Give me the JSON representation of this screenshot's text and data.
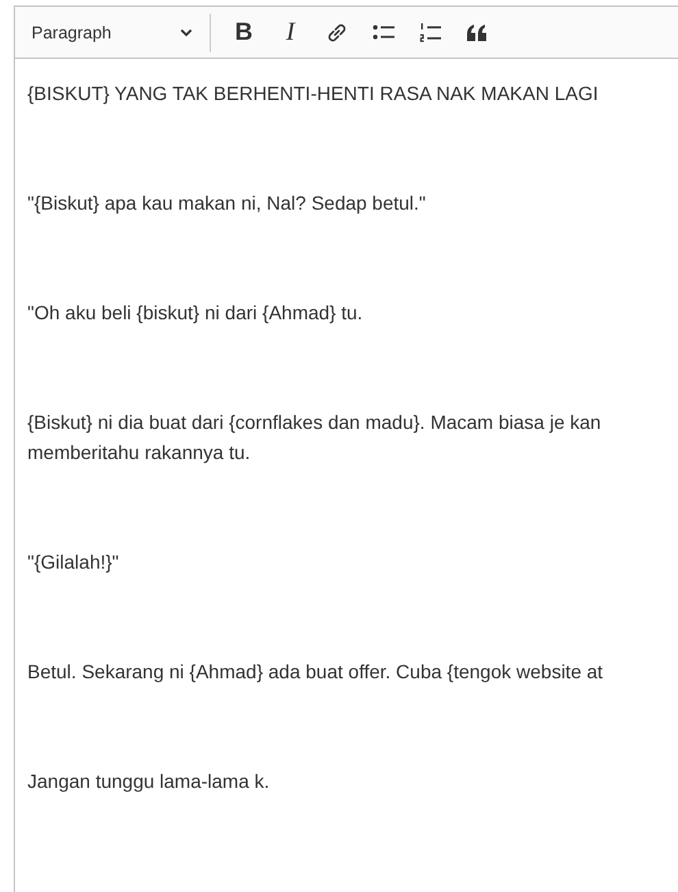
{
  "toolbar": {
    "heading_dropdown": {
      "value": "Paragraph"
    },
    "buttons": [
      {
        "kind": "bold",
        "label": "B"
      },
      {
        "kind": "italic",
        "label": "I"
      },
      {
        "kind": "link"
      },
      {
        "kind": "bulleted-list"
      },
      {
        "kind": "numbered-list"
      },
      {
        "kind": "block-quote"
      }
    ]
  },
  "paragraphs": [
    {
      "lines": [
        "{BISKUT} YANG TAK BERHENTI-HENTI RASA NAK MAKAN LAGI"
      ]
    },
    {
      "lines": [
        "\"{Biskut} apa kau makan ni, Nal? Sedap betul.\""
      ]
    },
    {
      "lines": [
        "\"Oh aku beli {biskut} ni dari {Ahmad} tu."
      ]
    },
    {
      "lines": [
        "{Biskut} ni dia buat dari {cornflakes dan madu}. Macam biasa je kan",
        "memberitahu rakannya tu."
      ]
    },
    {
      "lines": [
        "\"{Gilalah!}\""
      ]
    },
    {
      "lines": [
        "Betul. Sekarang ni {Ahmad} ada buat offer. Cuba {tengok website at"
      ]
    },
    {
      "lines": [
        "Jangan tunggu lama-lama k."
      ]
    }
  ]
}
